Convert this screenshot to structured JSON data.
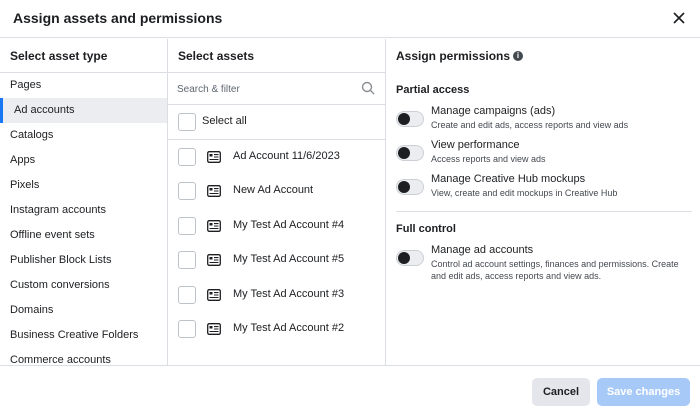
{
  "dialog": {
    "title": "Assign assets and permissions"
  },
  "asset_types": {
    "header": "Select asset type",
    "items": [
      {
        "label": "Pages",
        "selected": false
      },
      {
        "label": "Ad accounts",
        "selected": true
      },
      {
        "label": "Catalogs",
        "selected": false
      },
      {
        "label": "Apps",
        "selected": false
      },
      {
        "label": "Pixels",
        "selected": false
      },
      {
        "label": "Instagram accounts",
        "selected": false
      },
      {
        "label": "Offline event sets",
        "selected": false
      },
      {
        "label": "Publisher Block Lists",
        "selected": false
      },
      {
        "label": "Custom conversions",
        "selected": false
      },
      {
        "label": "Domains",
        "selected": false
      },
      {
        "label": "Business Creative Folders",
        "selected": false
      },
      {
        "label": "Commerce accounts",
        "selected": false
      }
    ]
  },
  "assets": {
    "header": "Select assets",
    "search_placeholder": "Search & filter",
    "select_all_label": "Select all",
    "items": [
      {
        "label": "Ad Account 11/6/2023",
        "icon": "ad-account-icon"
      },
      {
        "label": "New Ad Account",
        "icon": "ad-account-icon"
      },
      {
        "label": "My Test Ad Account #4",
        "icon": "ad-account-icon"
      },
      {
        "label": "My Test Ad Account #5",
        "icon": "ad-account-icon"
      },
      {
        "label": "My Test Ad Account #3",
        "icon": "ad-account-icon"
      },
      {
        "label": "My Test Ad Account #2",
        "icon": "ad-account-icon"
      }
    ]
  },
  "permissions": {
    "header": "Assign permissions",
    "partial": {
      "title": "Partial access",
      "items": [
        {
          "name": "Manage campaigns (ads)",
          "desc": "Create and edit ads, access reports and view ads",
          "on": false
        },
        {
          "name": "View performance",
          "desc": "Access reports and view ads",
          "on": false
        },
        {
          "name": "Manage Creative Hub mockups",
          "desc": "View, create and edit mockups in Creative Hub",
          "on": false
        }
      ]
    },
    "full": {
      "title": "Full control",
      "items": [
        {
          "name": "Manage ad accounts",
          "desc": "Control ad account settings, finances and permissions. Create and edit ads, access reports and view ads.",
          "on": false
        }
      ]
    }
  },
  "footer": {
    "cancel_label": "Cancel",
    "save_label": "Save changes"
  },
  "colors": {
    "accent": "#1877f2",
    "save_disabled": "#a7c9f8"
  }
}
